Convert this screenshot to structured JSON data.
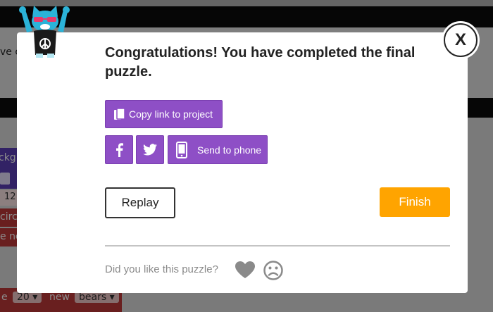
{
  "background": {
    "instruction_fragment": "ve c",
    "block_fragment_1": "ckgr",
    "number_value": "12",
    "block_fragment_2": "circl",
    "block_fragment_3": "e ne",
    "bottom_letter": "e",
    "bottom_number": "20",
    "bottom_word": "new",
    "bottom_sprite": "bears"
  },
  "modal": {
    "title": "Congratulations! You have completed the final puzzle.",
    "copy_link_label": "Copy link to project",
    "send_to_phone_label": "Send to phone",
    "replay_label": "Replay",
    "finish_label": "Finish",
    "feedback_prompt": "Did you like this puzzle?",
    "close_label": "X"
  },
  "icons": {
    "copy": "copy-icon",
    "facebook": "facebook-icon",
    "twitter": "twitter-icon",
    "phone": "phone-icon",
    "like": "heart-icon",
    "dislike": "frown-icon",
    "mascot": "cat-mascot-icon"
  },
  "colors": {
    "share_button": "#8e4fc6",
    "finish_button": "#ffa400",
    "overlay": "rgba(0,0,0,0.45)",
    "feedback_icons": "#8a8a8a"
  }
}
